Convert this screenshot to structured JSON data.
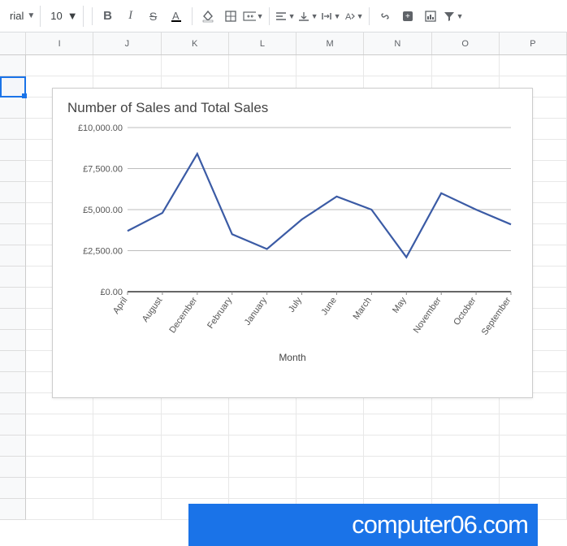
{
  "toolbar": {
    "font_name": "rial",
    "font_size": "10"
  },
  "columns": [
    "I",
    "J",
    "K",
    "L",
    "M",
    "N",
    "O",
    "P"
  ],
  "chart_data": {
    "type": "line",
    "title": "Number of Sales and Total Sales",
    "xlabel": "Month",
    "ylabel": "",
    "ylim": [
      0,
      10000
    ],
    "yticks": [
      0,
      2500,
      5000,
      7500,
      10000
    ],
    "ytick_labels": [
      "£0.00",
      "£2,500.00",
      "£5,000.00",
      "£7,500.00",
      "£10,000.00"
    ],
    "categories": [
      "April",
      "August",
      "December",
      "February",
      "January",
      "July",
      "June",
      "March",
      "May",
      "November",
      "October",
      "September"
    ],
    "values": [
      3700,
      4800,
      8400,
      3500,
      2600,
      4400,
      5800,
      5000,
      2100,
      6000,
      5000,
      4100
    ],
    "colors": {
      "series": "#3b5ba5"
    }
  },
  "watermark": "computer06.com"
}
